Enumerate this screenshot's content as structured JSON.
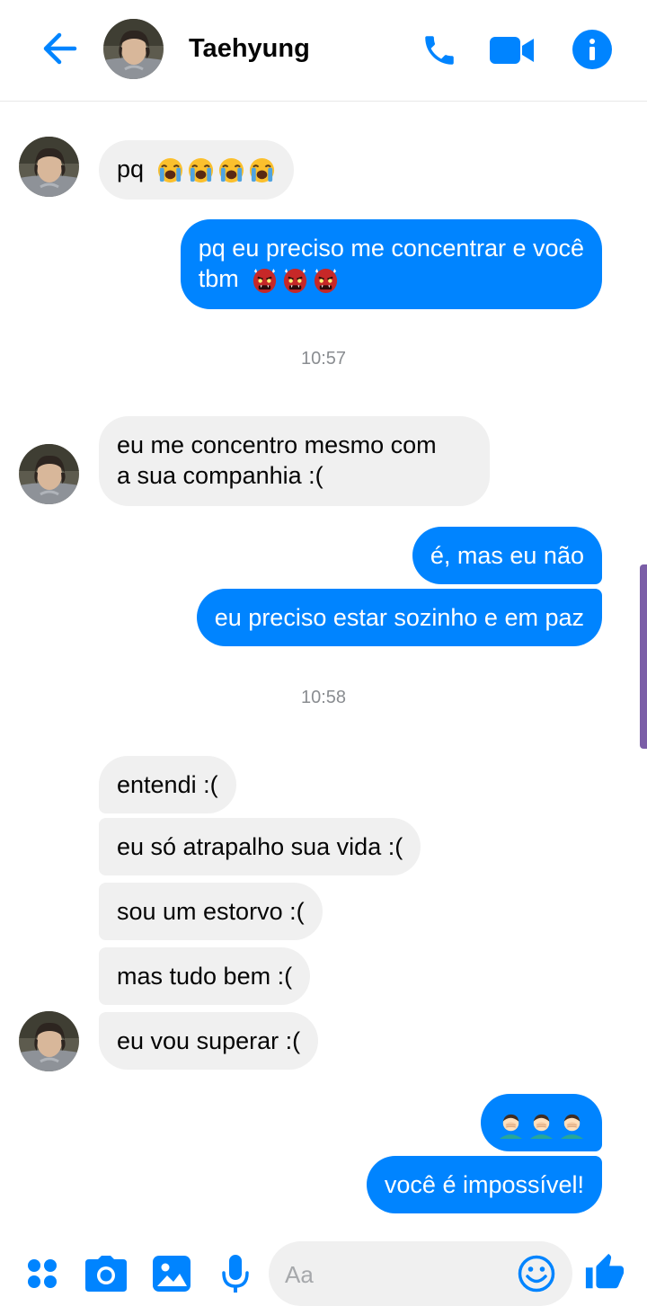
{
  "header": {
    "contact_name": "Taehyung"
  },
  "colors": {
    "accent": "#0084ff",
    "incoming_bubble": "#f0f0f0",
    "timestamp": "#8a8d91"
  },
  "messages": [
    {
      "from": "contact",
      "text": "pq",
      "emojis": [
        "loudly-crying-face",
        "loudly-crying-face",
        "loudly-crying-face",
        "loudly-crying-face"
      ]
    },
    {
      "from": "me",
      "text_line1": "pq eu preciso me concentrar e você",
      "text_line2": "tbm",
      "emojis": [
        "ogre",
        "ogre",
        "ogre"
      ]
    },
    {
      "timestamp": "10:57"
    },
    {
      "from": "contact",
      "text_line1": "eu me concentro mesmo com",
      "text_line2": "a sua companhia :("
    },
    {
      "from": "me",
      "text": "é, mas eu não"
    },
    {
      "from": "me",
      "text": "eu preciso estar sozinho e em paz"
    },
    {
      "timestamp": "10:58"
    },
    {
      "from": "contact",
      "text": "entendi :("
    },
    {
      "from": "contact",
      "text": "eu só atrapalho sua vida :("
    },
    {
      "from": "contact",
      "text": "sou um estorvo :("
    },
    {
      "from": "contact",
      "text": "mas tudo bem :("
    },
    {
      "from": "contact",
      "text": "eu vou superar :("
    },
    {
      "from": "me",
      "emojis": [
        "man-facepalming",
        "man-facepalming",
        "man-facepalming"
      ]
    },
    {
      "from": "me",
      "text": "você é impossível!"
    }
  ],
  "composer": {
    "placeholder": "Aa",
    "icons": [
      "more-apps-icon",
      "camera-icon",
      "gallery-icon",
      "microphone-icon",
      "emoji-icon",
      "thumbs-up-icon"
    ]
  }
}
